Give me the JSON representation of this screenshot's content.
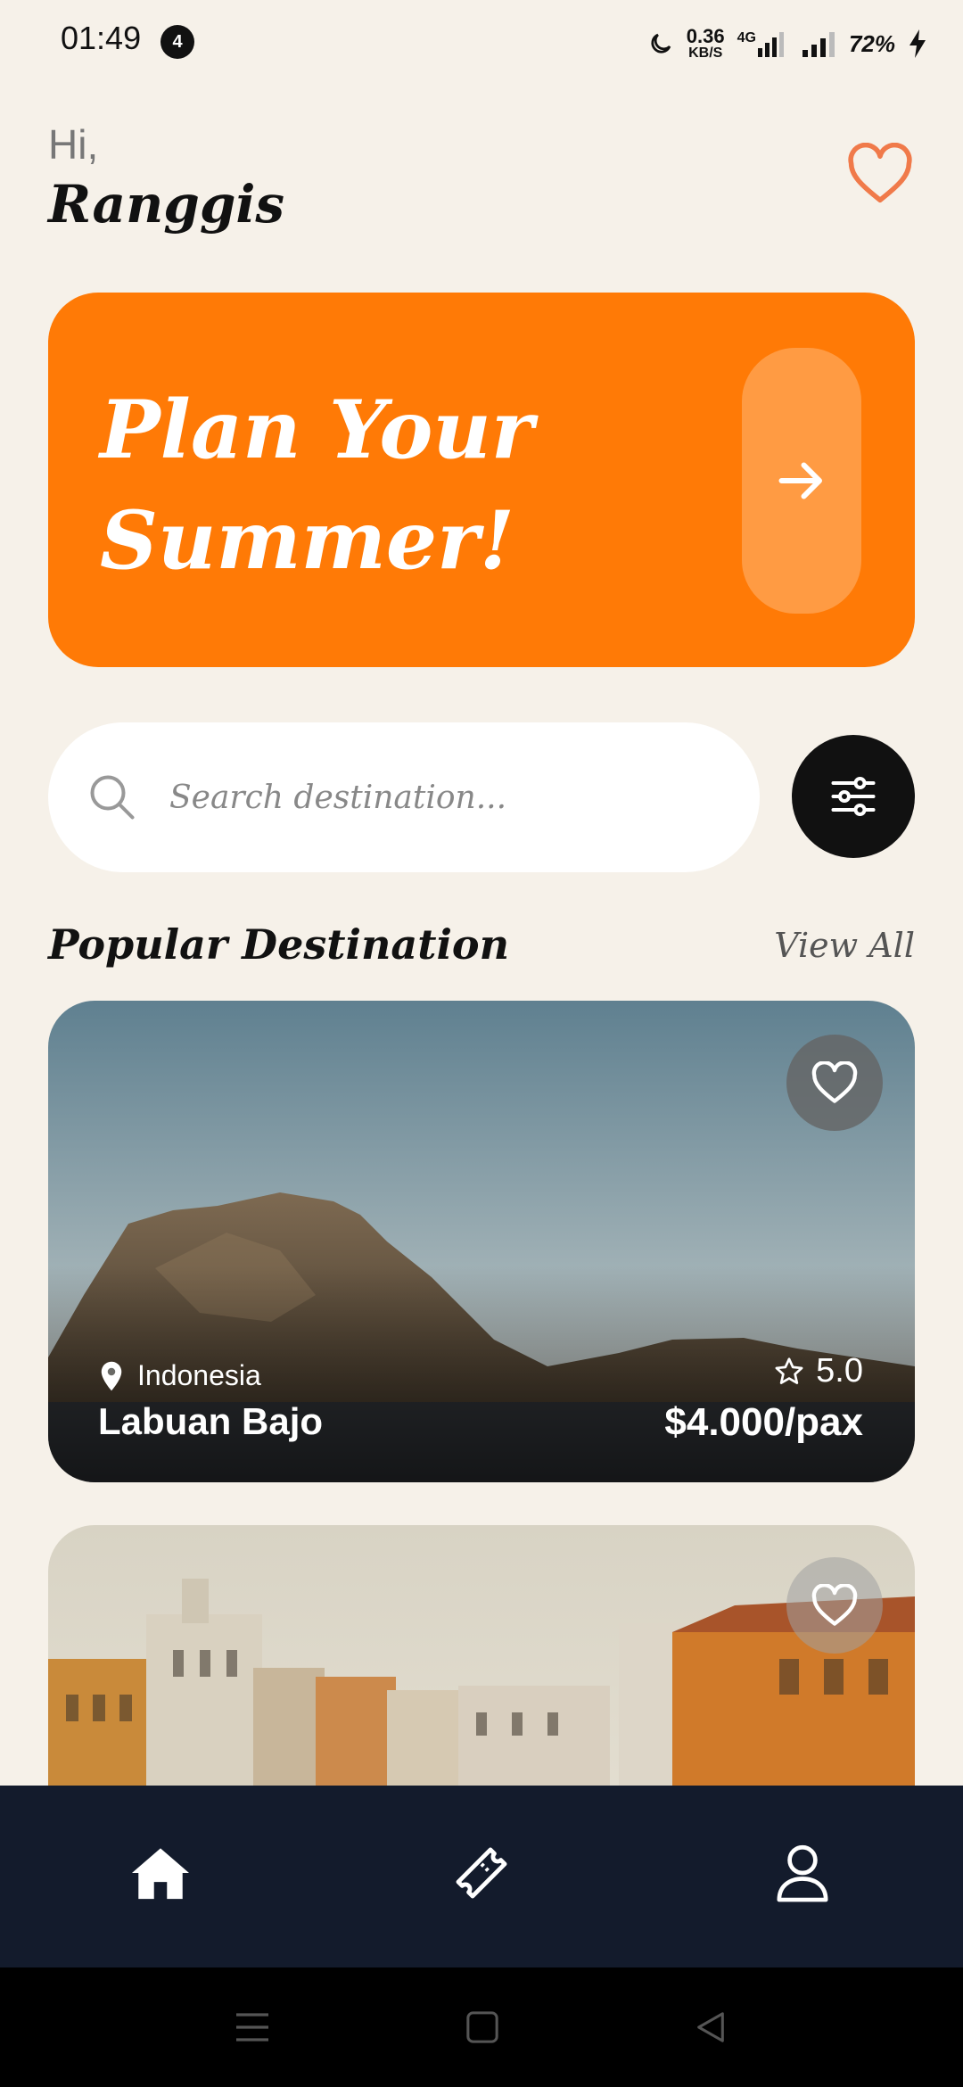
{
  "status_bar": {
    "time": "01:49",
    "notification_count": "4",
    "net_speed_value": "0.36",
    "net_speed_unit": "KB/S",
    "network_type": "4G",
    "battery": "72%"
  },
  "greeting": {
    "hi": "Hi,",
    "name": "Ranggis"
  },
  "banner": {
    "title": "Plan Your Summer!"
  },
  "search": {
    "placeholder": "Search destination..."
  },
  "section": {
    "title": "Popular Destination",
    "view_all": "View All"
  },
  "destinations": [
    {
      "country": "Indonesia",
      "name": "Labuan Bajo",
      "rating": "5.0",
      "price": "$4.000/pax"
    }
  ],
  "bottom_nav": [
    {
      "icon": "home-icon"
    },
    {
      "icon": "ticket-icon"
    },
    {
      "icon": "profile-icon"
    }
  ],
  "colors": {
    "background": "#f6f1e9",
    "accent": "#ff7a06",
    "accent_light": "#ff9b43",
    "nav_bg": "#131b2c",
    "heart": "#f07a4a"
  }
}
